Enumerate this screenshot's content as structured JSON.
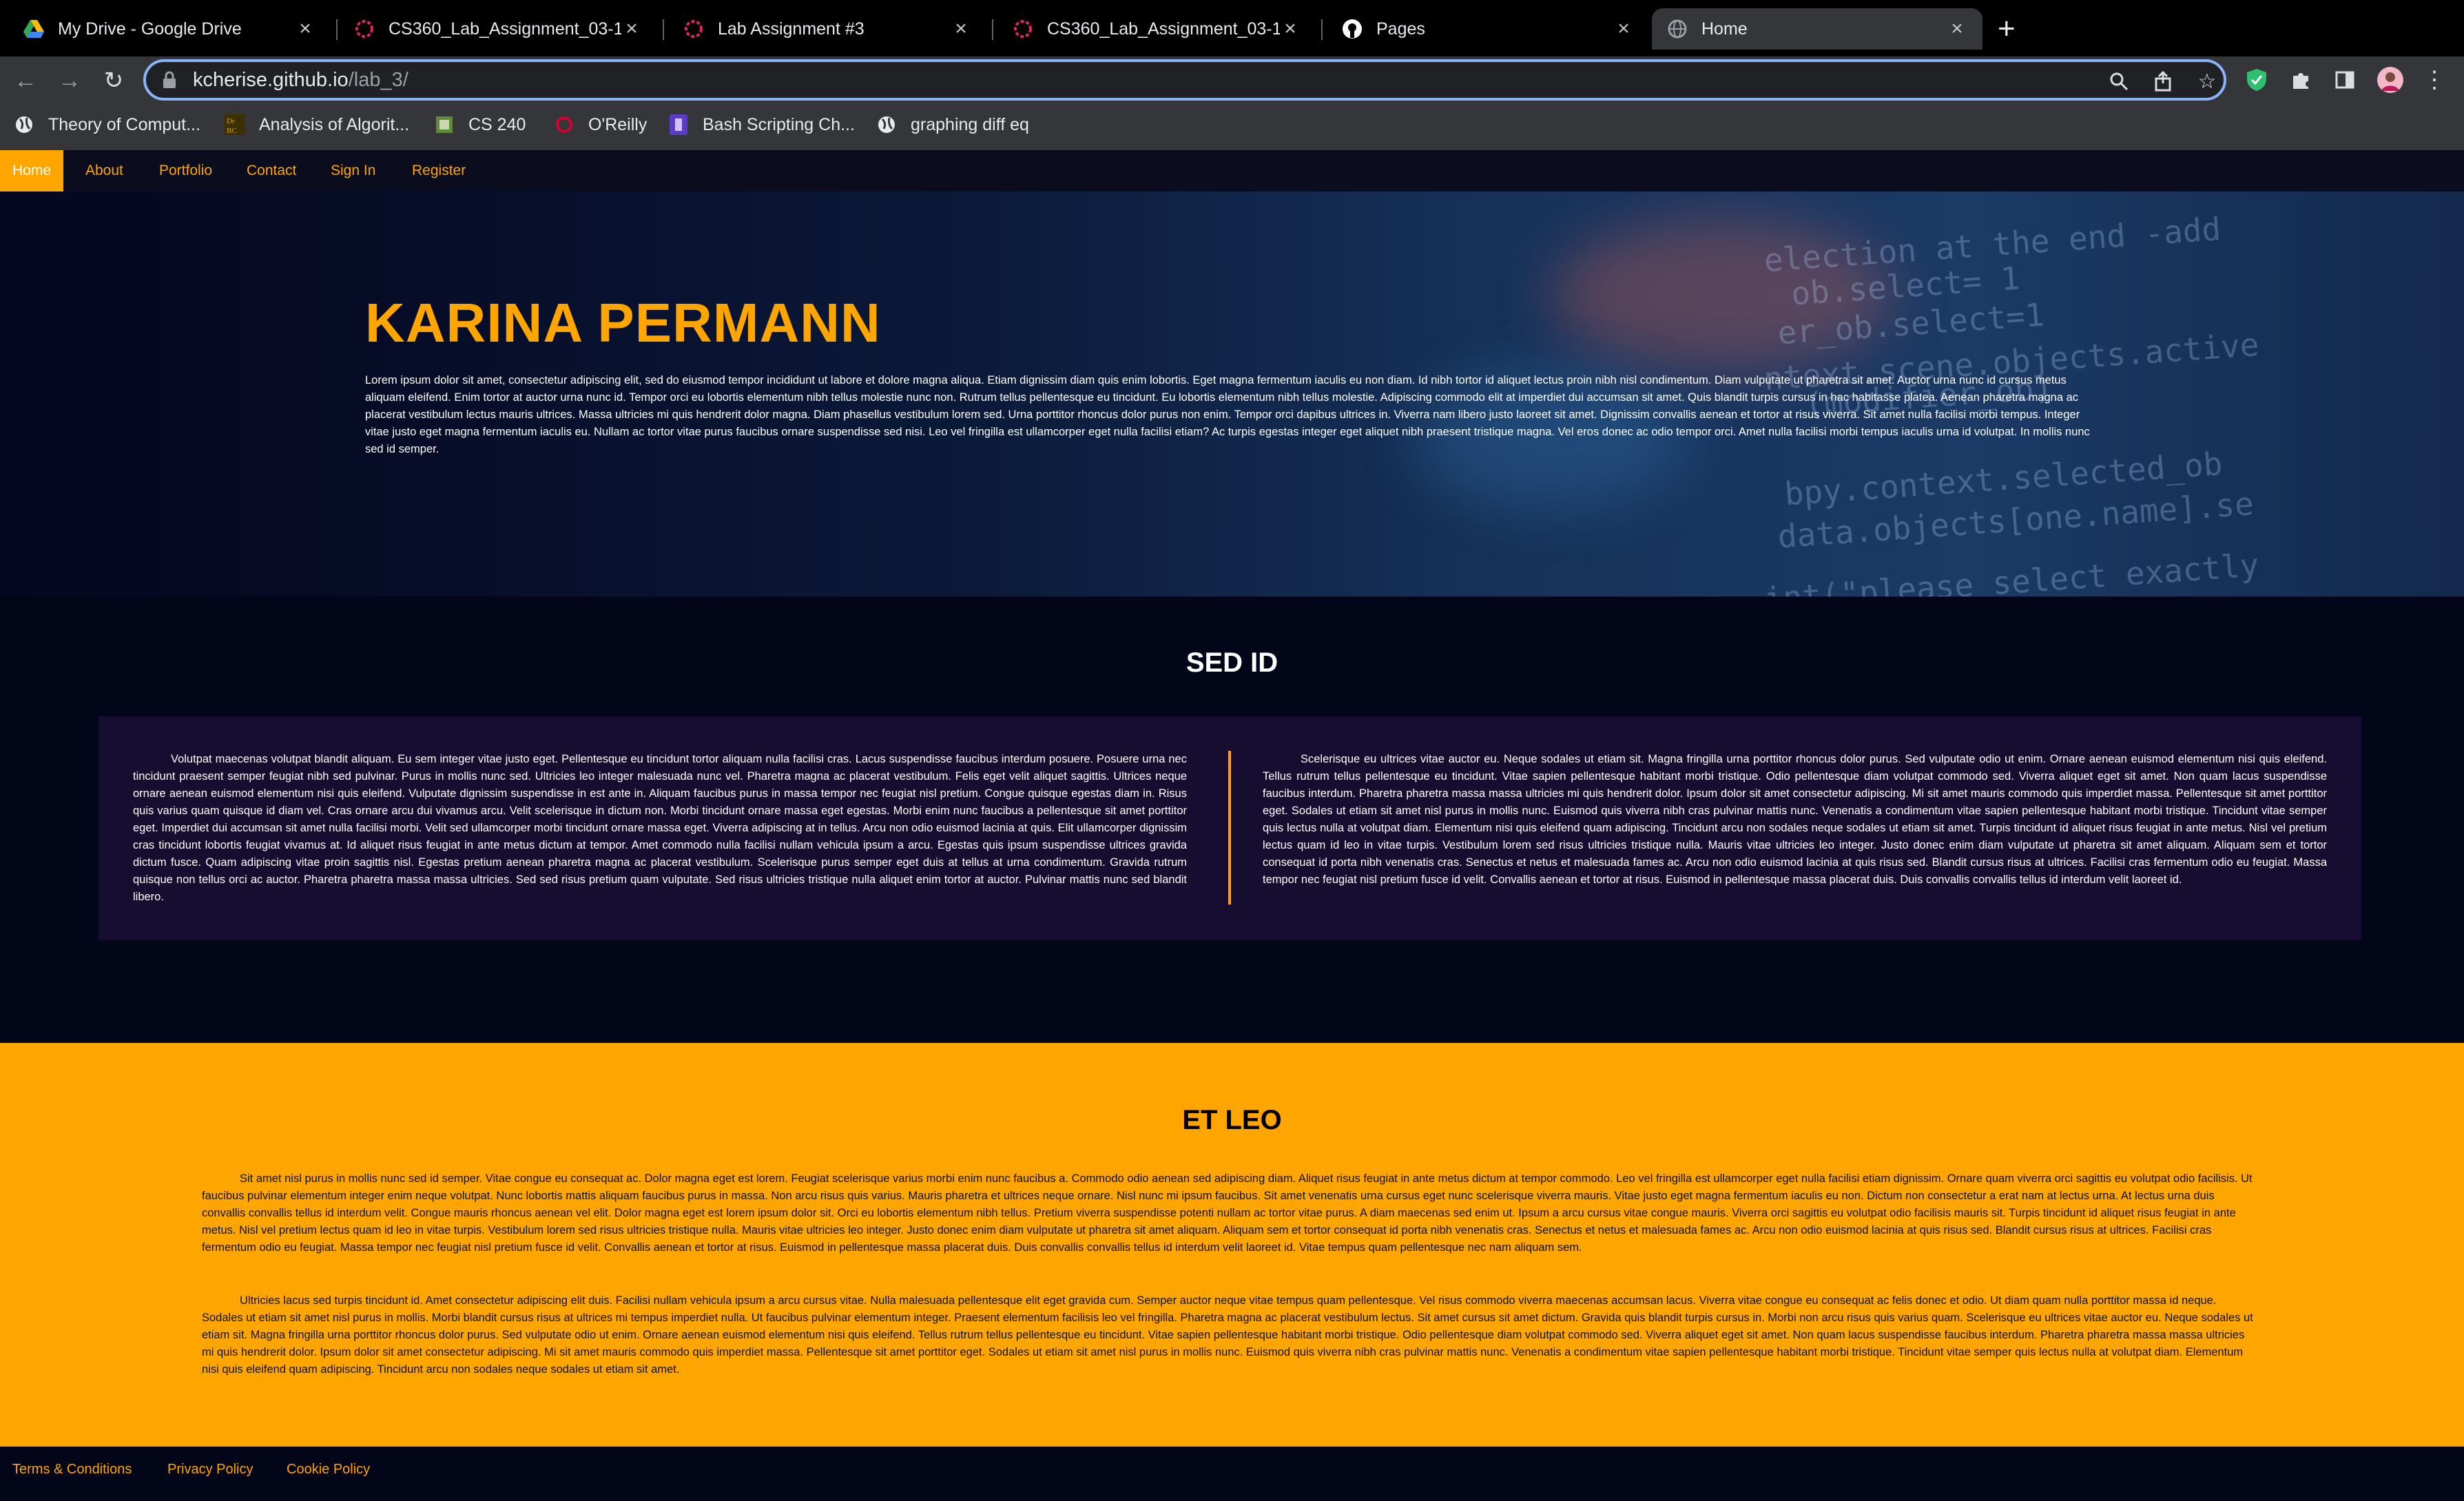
{
  "browser": {
    "tabs": [
      {
        "title": "My Drive - Google Drive",
        "icon": "google-drive-icon"
      },
      {
        "title": "CS360_Lab_Assignment_03-1",
        "icon": "canvas-icon"
      },
      {
        "title": "Lab Assignment #3",
        "icon": "canvas-icon"
      },
      {
        "title": "CS360_Lab_Assignment_03-1",
        "icon": "canvas-icon"
      },
      {
        "title": "Pages",
        "icon": "github-icon"
      },
      {
        "title": "Home",
        "icon": "globe-icon"
      }
    ],
    "url_host": "kcherise.github.io",
    "url_path": "/lab_3/",
    "bookmarks": [
      {
        "label": "Theory of Comput...",
        "icon": "globe-icon"
      },
      {
        "label": "Analysis of Algorit...",
        "icon": "drbc-icon"
      },
      {
        "label": "CS 240",
        "icon": "book-icon"
      },
      {
        "label": "O'Reilly",
        "icon": "oreilly-icon"
      },
      {
        "label": "Bash Scripting Ch...",
        "icon": "bash-icon"
      },
      {
        "label": "graphing diff eq",
        "icon": "globe-icon"
      }
    ],
    "accent": "#8ab4f8"
  },
  "nav": {
    "items": [
      "Home",
      "About",
      "Portfolio",
      "Contact",
      "Sign In",
      "Register"
    ],
    "accent": "#ffa500"
  },
  "hero": {
    "title": "KARINA PERMANN",
    "text": "Lorem ipsum dolor sit amet, consectetur adipiscing elit, sed do eiusmod tempor incididunt ut labore et dolore magna aliqua. Etiam dignissim diam quis enim lobortis. Eget magna fermentum iaculis eu non diam. Id nibh tortor id aliquet lectus proin nibh nisl condimentum. Diam vulputate ut pharetra sit amet. Auctor urna nunc id cursus metus aliquam eleifend. Enim tortor at auctor urna nunc id. Tempor orci eu lobortis elementum nibh tellus molestie nunc non. Rutrum tellus pellentesque eu tincidunt. Eu lobortis elementum nibh tellus molestie. Adipiscing commodo elit at imperdiet dui accumsan sit amet. Quis blandit turpis cursus in hac habitasse platea. Aenean pharetra magna ac placerat vestibulum lectus mauris ultrices. Massa ultricies mi quis hendrerit dolor magna. Diam phasellus vestibulum lorem sed. Urna porttitor rhoncus dolor purus non enim. Tempor orci dapibus ultrices in. Viverra nam libero justo laoreet sit amet. Dignissim convallis aenean et tortor at risus viverra. Sit amet nulla facilisi morbi tempus. Integer vitae justo eget magna fermentum iaculis eu. Nullam ac tortor vitae purus faucibus ornare suspendisse sed nisi. Leo vel fringilla est ullamcorper eget nulla facilisi etiam? Ac turpis egestas integer eget aliquet nibh praesent tristique magna. Vel eros donec ac odio tempor orci. Amet nulla facilisi morbi tempus iaculis urna id volutpat. In mollis nunc sed id semper."
  },
  "sed": {
    "title": "SED ID",
    "left": "Volutpat maecenas volutpat blandit aliquam. Eu sem integer vitae justo eget. Pellentesque eu tincidunt tortor aliquam nulla facilisi cras. Lacus suspendisse faucibus interdum posuere. Posuere urna nec tincidunt praesent semper feugiat nibh sed pulvinar. Purus in mollis nunc sed. Ultricies leo integer malesuada nunc vel. Pharetra magna ac placerat vestibulum. Felis eget velit aliquet sagittis. Ultrices neque ornare aenean euismod elementum nisi quis eleifend. Vulputate dignissim suspendisse in est ante in. Aliquam faucibus purus in massa tempor nec feugiat nisl pretium. Congue quisque egestas diam in. Risus quis varius quam quisque id diam vel. Cras ornare arcu dui vivamus arcu. Velit scelerisque in dictum non. Morbi tincidunt ornare massa eget egestas. Morbi enim nunc faucibus a pellentesque sit amet porttitor eget. Imperdiet dui accumsan sit amet nulla facilisi morbi. Velit sed ullamcorper morbi tincidunt ornare massa eget. Viverra adipiscing at in tellus. Arcu non odio euismod lacinia at quis. Elit ullamcorper dignissim cras tincidunt lobortis feugiat vivamus at. Id aliquet risus feugiat in ante metus dictum at tempor. Amet commodo nulla facilisi nullam vehicula ipsum a arcu. Egestas quis ipsum suspendisse ultrices gravida dictum fusce. Quam adipiscing vitae proin sagittis nisl. Egestas pretium aenean pharetra magna ac placerat vestibulum. Scelerisque purus semper eget duis at tellus at urna condimentum. Gravida rutrum quisque non tellus orci ac auctor. Pharetra pharetra massa massa ultricies. Sed sed risus pretium quam vulputate. Sed risus ultricies tristique nulla aliquet enim tortor at auctor. Pulvinar mattis nunc sed blandit libero.",
    "right": "Scelerisque eu ultrices vitae auctor eu. Neque sodales ut etiam sit. Magna fringilla urna porttitor rhoncus dolor purus. Sed vulputate odio ut enim. Ornare aenean euismod elementum nisi quis eleifend. Tellus rutrum tellus pellentesque eu tincidunt. Vitae sapien pellentesque habitant morbi tristique. Odio pellentesque diam volutpat commodo sed. Viverra aliquet eget sit amet. Non quam lacus suspendisse faucibus interdum. Pharetra pharetra massa massa ultricies mi quis hendrerit dolor. Ipsum dolor sit amet consectetur adipiscing. Mi sit amet mauris commodo quis imperdiet massa. Pellentesque sit amet porttitor eget. Sodales ut etiam sit amet nisl purus in mollis nunc. Euismod quis viverra nibh cras pulvinar mattis nunc. Venenatis a condimentum vitae sapien pellentesque habitant morbi tristique. Tincidunt vitae semper quis lectus nulla at volutpat diam. Elementum nisi quis eleifend quam adipiscing. Tincidunt arcu non sodales neque sodales ut etiam sit amet. Turpis tincidunt id aliquet risus feugiat in ante metus. Nisl vel pretium lectus quam id leo in vitae turpis. Vestibulum lorem sed risus ultricies tristique nulla. Mauris vitae ultricies leo integer. Justo donec enim diam vulputate ut pharetra sit amet aliquam. Aliquam sem et tortor consequat id porta nibh venenatis cras. Senectus et netus et malesuada fames ac. Arcu non odio euismod lacinia at quis risus sed. Blandit cursus risus at ultrices. Facilisi cras fermentum odio eu feugiat. Massa tempor nec feugiat nisl pretium fusce id velit. Convallis aenean et tortor at risus. Euismod in pellentesque massa placerat duis. Duis convallis convallis tellus id interdum velit laoreet id."
  },
  "etleo": {
    "title": "ET LEO",
    "p1": "Sit amet nisl purus in mollis nunc sed id semper. Vitae congue eu consequat ac. Dolor magna eget est lorem. Feugiat scelerisque varius morbi enim nunc faucibus a. Commodo odio aenean sed adipiscing diam. Aliquet risus feugiat in ante metus dictum at tempor commodo. Leo vel fringilla est ullamcorper eget nulla facilisi etiam dignissim. Ornare quam viverra orci sagittis eu volutpat odio facilisis. Ut faucibus pulvinar elementum integer enim neque volutpat. Nunc lobortis mattis aliquam faucibus purus in massa. Non arcu risus quis varius. Mauris pharetra et ultrices neque ornare. Nisl nunc mi ipsum faucibus. Sit amet venenatis urna cursus eget nunc scelerisque viverra mauris. Vitae justo eget magna fermentum iaculis eu non. Dictum non consectetur a erat nam at lectus urna. At lectus urna duis convallis convallis tellus id interdum velit. Congue mauris rhoncus aenean vel elit. Dolor magna eget est lorem ipsum dolor sit. Orci eu lobortis elementum nibh tellus. Pretium viverra suspendisse potenti nullam ac tortor vitae purus. A diam maecenas sed enim ut. Ipsum a arcu cursus vitae congue mauris. Viverra orci sagittis eu volutpat odio facilisis mauris sit. Turpis tincidunt id aliquet risus feugiat in ante metus. Nisl vel pretium lectus quam id leo in vitae turpis. Vestibulum lorem sed risus ultricies tristique nulla. Mauris vitae ultricies leo integer. Justo donec enim diam vulputate ut pharetra sit amet aliquam. Aliquam sem et tortor consequat id porta nibh venenatis cras. Senectus et netus et malesuada fames ac. Arcu non odio euismod lacinia at quis risus sed. Blandit cursus risus at ultrices. Facilisi cras fermentum odio eu feugiat. Massa tempor nec feugiat nisl pretium fusce id velit. Convallis aenean et tortor at risus. Euismod in pellentesque massa placerat duis. Duis convallis convallis tellus id interdum velit laoreet id. Vitae tempus quam pellentesque nec nam aliquam sem.",
    "p2": "Ultricies lacus sed turpis tincidunt id. Amet consectetur adipiscing elit duis. Facilisi nullam vehicula ipsum a arcu cursus vitae. Nulla malesuada pellentesque elit eget gravida cum. Semper auctor neque vitae tempus quam pellentesque. Vel risus commodo viverra maecenas accumsan lacus. Viverra vitae congue eu consequat ac felis donec et odio. Ut diam quam nulla porttitor massa id neque. Sodales ut etiam sit amet nisl purus in mollis. Morbi blandit cursus risus at ultrices mi tempus imperdiet nulla. Ut faucibus pulvinar elementum integer. Praesent elementum facilisis leo vel fringilla. Pharetra magna ac placerat vestibulum lectus. Sit amet cursus sit amet dictum. Gravida quis blandit turpis cursus in. Morbi non arcu risus quis varius quam. Scelerisque eu ultrices vitae auctor eu. Neque sodales ut etiam sit. Magna fringilla urna porttitor rhoncus dolor purus. Sed vulputate odio ut enim. Ornare aenean euismod elementum nisi quis eleifend. Tellus rutrum tellus pellentesque eu tincidunt. Vitae sapien pellentesque habitant morbi tristique. Odio pellentesque diam volutpat commodo sed. Viverra aliquet eget sit amet. Non quam lacus suspendisse faucibus interdum. Pharetra pharetra massa massa ultricies mi quis hendrerit dolor. Ipsum dolor sit amet consectetur adipiscing. Mi sit amet mauris commodo quis imperdiet massa. Pellentesque sit amet porttitor eget. Sodales ut etiam sit amet nisl purus in mollis nunc. Euismod quis viverra nibh cras pulvinar mattis nunc. Venenatis a condimentum vitae sapien pellentesque habitant morbi tristique. Tincidunt vitae semper quis lectus nulla at volutpat diam. Elementum nisi quis eleifend quam adipiscing. Tincidunt arcu non sodales neque sodales ut etiam sit amet.",
    "background": "#ffa500"
  },
  "footer": {
    "links": [
      "Terms & Conditions",
      "Privacy Policy",
      "Cookie Policy"
    ]
  }
}
